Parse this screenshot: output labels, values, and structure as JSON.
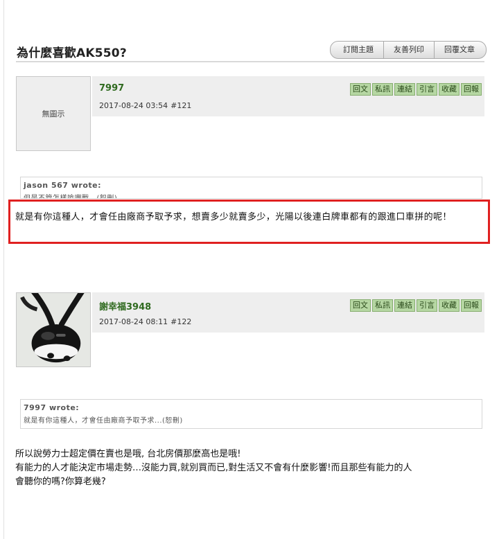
{
  "thread": {
    "title": "為什麼喜歡AK550?",
    "buttons": [
      "訂閱主題",
      "友善列印",
      "回覆文章"
    ]
  },
  "post_actions": [
    "回文",
    "私訊",
    "連結",
    "引言",
    "收藏",
    "回報"
  ],
  "posts": [
    {
      "avatar_text": "無圖示",
      "author": "7997",
      "date": "2017-08-24 03:54",
      "number": "#121",
      "quote_author": "jason 567 wrote:",
      "quote_text": "但是不管怎樣喰嘲戰...(恕刪)",
      "body": "就是有你這種人，才會任由廠商予取予求，想賣多少就賣多少，光陽以後連白牌車都有的跟進口車拼的呢！"
    },
    {
      "author": "謝幸福3948",
      "date": "2017-08-24 08:11",
      "number": "#122",
      "quote_author": "7997 wrote:",
      "quote_text": "就是有你這種人，才會任由廠商予取予求...(恕刪)",
      "body_lines": [
        "所以說勞力士超定價在賣也是哦, 台北房價那麼高也是哦!",
        "有能力的人才能決定市場走勢…沒能力買,就別買而已,對生活又不會有什麼影響!而且那些有能力的人",
        "會聽你的嗎?你算老幾?"
      ]
    }
  ]
}
